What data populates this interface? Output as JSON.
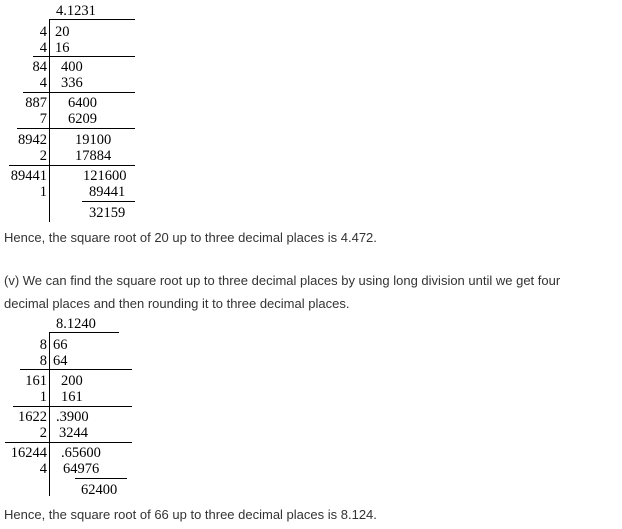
{
  "division1": {
    "quotient": "4.1231",
    "rows": [
      {
        "divisor": "4",
        "value": "20"
      },
      {
        "divisor": "4",
        "value": "16"
      },
      {
        "divisor": "84",
        "value": "400"
      },
      {
        "divisor": "4",
        "value": "336"
      },
      {
        "divisor": "887",
        "value": "6400"
      },
      {
        "divisor": "7",
        "value": "6209"
      },
      {
        "divisor": "8942",
        "value": "19100"
      },
      {
        "divisor": "2",
        "value": "17884"
      },
      {
        "divisor": "89441",
        "value": "121600"
      },
      {
        "divisor": "1",
        "value": "89441"
      }
    ],
    "remainder": "32159"
  },
  "conclusion1": "Hence, the square root of 20 up to three decimal places is 4.472.",
  "intro2": {
    "line1": "(v) We can find the square root up to three decimal places by using long division until we get four",
    "line2": "decimal places and then rounding it to three decimal places."
  },
  "division2": {
    "quotient": "8.1240",
    "rows": [
      {
        "divisor": "8",
        "value": "66"
      },
      {
        "divisor": "8",
        "value": "64"
      },
      {
        "divisor": "161",
        "value": "200"
      },
      {
        "divisor": "1",
        "value": "161"
      },
      {
        "divisor": "1622",
        "value": ".3900"
      },
      {
        "divisor": "2",
        "value": "3244"
      },
      {
        "divisor": "16244",
        "value": ".65600"
      },
      {
        "divisor": "4",
        "value": "64976"
      }
    ],
    "remainder": "62400"
  },
  "conclusion2": "Hence, the square root of 66 up to three decimal places is 8.124."
}
